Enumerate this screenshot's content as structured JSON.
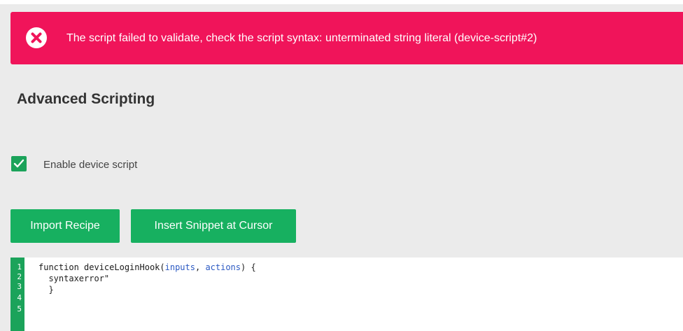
{
  "alert": {
    "message": "The script failed to validate, check the script syntax: unterminated string literal (device-script#2)",
    "icon": "error-circle-x-icon",
    "color": "#f0145a"
  },
  "section": {
    "title": "Advanced Scripting"
  },
  "enable_script": {
    "label": "Enable device script",
    "checked": true
  },
  "buttons": {
    "import_label": "Import Recipe",
    "snippet_label": "Insert Snippet at Cursor",
    "color": "#17b060"
  },
  "editor": {
    "line_numbers": [
      "1",
      "2",
      "3",
      "4",
      "5"
    ],
    "lines": {
      "l1_prefix": "function deviceLoginHook(",
      "l1_param1": "inputs",
      "l1_sep": ", ",
      "l1_param2": "actions",
      "l1_suffix": ") {",
      "l2": "  syntaxerror\"",
      "l3": "  }"
    }
  }
}
